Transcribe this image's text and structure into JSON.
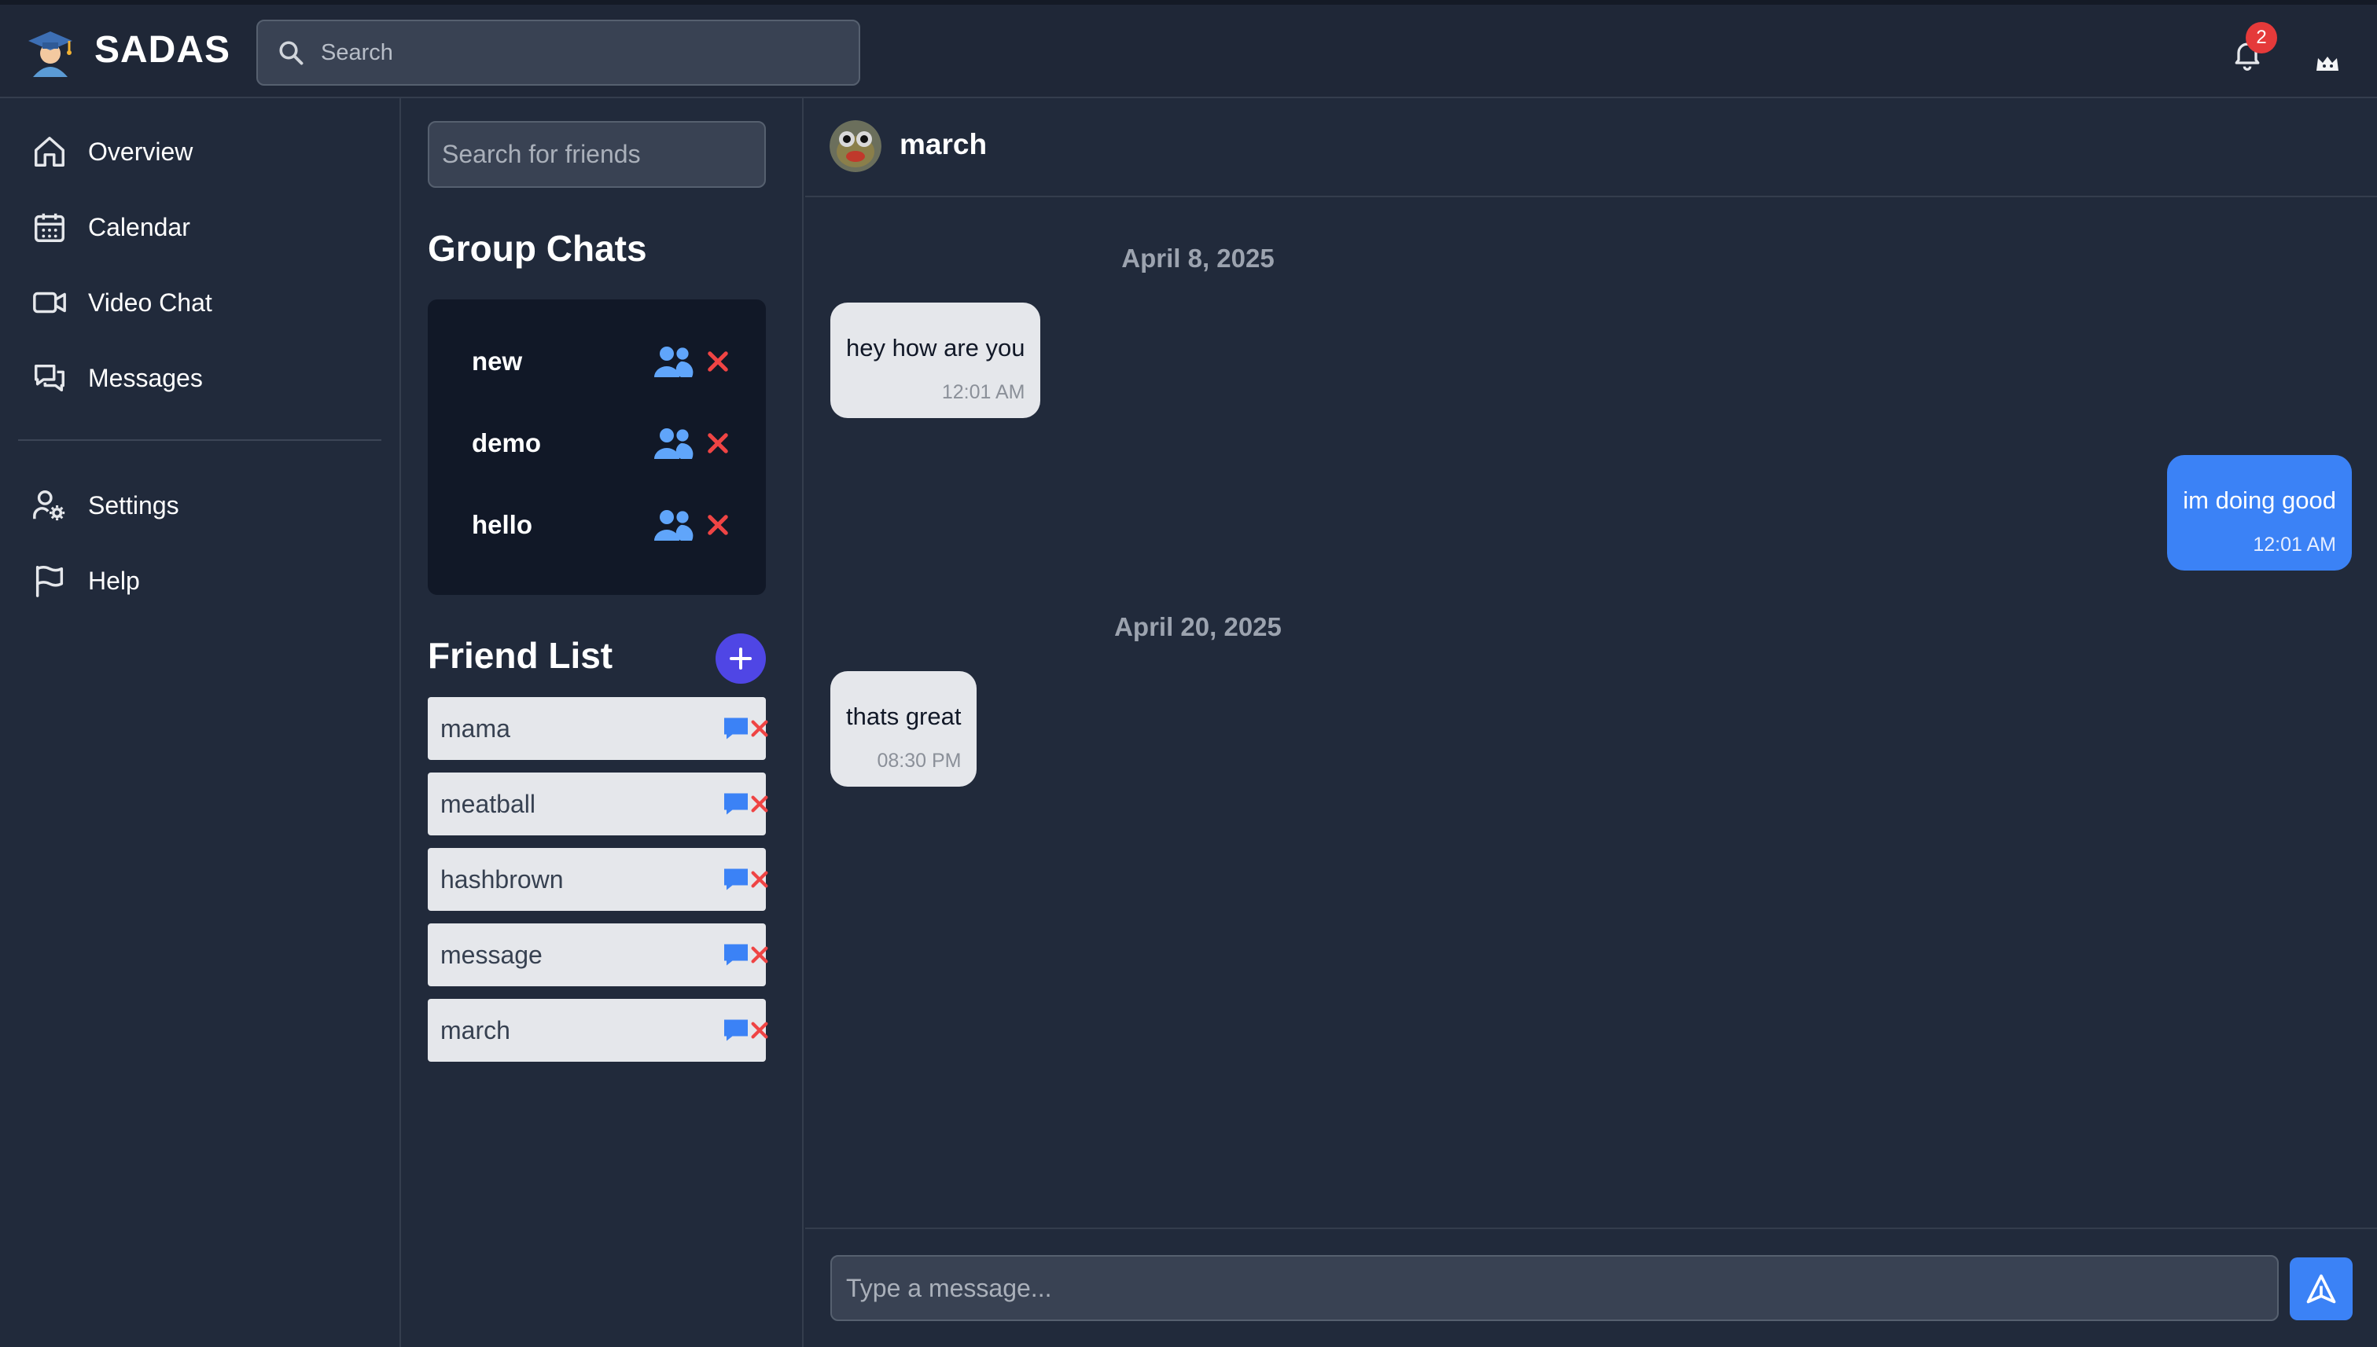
{
  "app": {
    "brand": "SADAS"
  },
  "top_search": {
    "placeholder": "Search"
  },
  "notifications": {
    "count": "2"
  },
  "nav": {
    "items": [
      {
        "label": "Overview",
        "icon": "home-icon"
      },
      {
        "label": "Calendar",
        "icon": "calendar-icon"
      },
      {
        "label": "Video Chat",
        "icon": "video-icon"
      },
      {
        "label": "Messages",
        "icon": "chat-bubbles-icon"
      }
    ],
    "bottom_items": [
      {
        "label": "Settings",
        "icon": "user-gear-icon"
      },
      {
        "label": "Help",
        "icon": "flag-icon"
      }
    ]
  },
  "friends_panel": {
    "search_placeholder": "Search for friends",
    "group_title": "Group Chats",
    "groups": [
      "new",
      "demo",
      "hello"
    ],
    "friend_title": "Friend List",
    "friends": [
      "mama",
      "meatball",
      "hashbrown",
      "message",
      "march"
    ]
  },
  "chat": {
    "contact_name": "march",
    "messages": [
      {
        "date": "April 8, 2025"
      },
      {
        "text": "hey how are you",
        "time": "12:01 AM",
        "direction": "incoming"
      },
      {
        "text": "im doing good",
        "time": "12:01 AM",
        "direction": "outgoing"
      },
      {
        "date": "April 20, 2025"
      },
      {
        "text": "thats great",
        "time": "08:30 PM",
        "direction": "incoming"
      }
    ],
    "input_placeholder": "Type a message..."
  },
  "colors": {
    "background": "#212a3b",
    "accent_blue": "#3b82f6",
    "indigo": "#4f46e5",
    "danger": "#ef4444",
    "group_icon": "#60a5fa"
  }
}
